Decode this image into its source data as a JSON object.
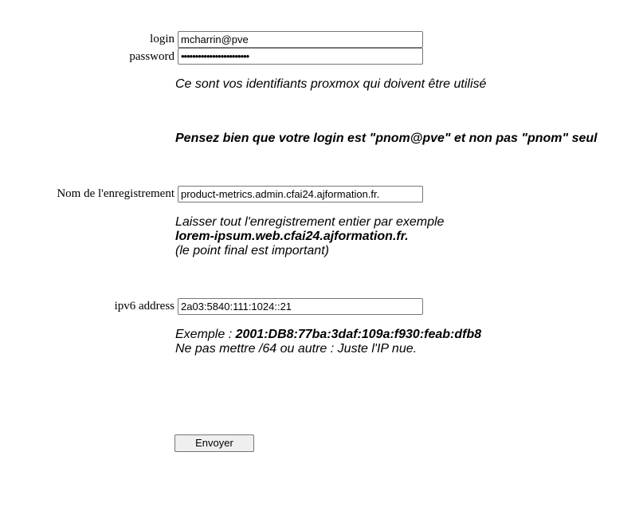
{
  "form": {
    "login_label": "login",
    "login_value": "mcharrin@pve",
    "password_label": "password",
    "password_value": "••••••••••••••••••••••••",
    "note_identifiers": "Ce sont vos identifiants proxmox qui doivent être utilisé",
    "note_login_warning": "Pensez bien que votre login est \"pnom@pve\" et non pas \"pnom\" seul",
    "record_label": "Nom de l'enregistrement",
    "record_value": "product-metrics.admin.cfai24.ajformation.fr.",
    "record_help_line1": "Laisser tout l'enregistrement entier par exemple",
    "record_help_example": "lorem-ipsum.web.cfai24.ajformation.fr.",
    "record_help_line3": "(le point final est important)",
    "ipv6_label": "ipv6 address",
    "ipv6_value": "2a03:5840:111:1024::21",
    "ipv6_example_prefix": "Exemple : ",
    "ipv6_example_value": "2001:DB8:77ba:3daf:109a:f930:feab:dfb8",
    "ipv6_help_line2": "Ne pas mettre /64 ou autre : Juste l'IP nue.",
    "submit_label": "Envoyer"
  }
}
